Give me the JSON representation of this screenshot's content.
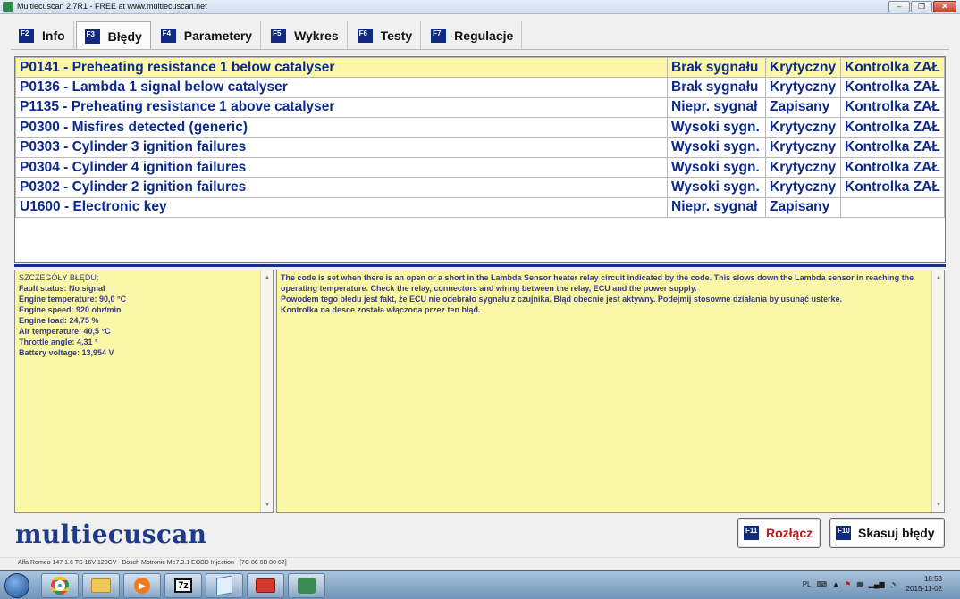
{
  "window": {
    "title": "Multiecuscan 2.7R1 - FREE at www.multiecuscan.net"
  },
  "tabs": [
    {
      "key": "F2",
      "label": "Info"
    },
    {
      "key": "F3",
      "label": "Błędy"
    },
    {
      "key": "F4",
      "label": "Parametery"
    },
    {
      "key": "F5",
      "label": "Wykres"
    },
    {
      "key": "F6",
      "label": "Testy"
    },
    {
      "key": "F7",
      "label": "Regulacje"
    }
  ],
  "errors": [
    {
      "code": "P0141 - Preheating resistance 1 below catalyser",
      "signal": "Brak sygnału",
      "type": "Krytyczny",
      "lamp": "Kontrolka ZAŁ"
    },
    {
      "code": "P0136 - Lambda 1 signal below catalyser",
      "signal": "Brak sygnału",
      "type": "Krytyczny",
      "lamp": "Kontrolka ZAŁ"
    },
    {
      "code": "P1135 - Preheating resistance 1 above catalyser",
      "signal": "Niepr. sygnał",
      "type": "Zapisany",
      "lamp": "Kontrolka ZAŁ"
    },
    {
      "code": "P0300 - Misfires detected (generic)",
      "signal": "Wysoki sygn.",
      "type": "Krytyczny",
      "lamp": "Kontrolka ZAŁ"
    },
    {
      "code": "P0303 - Cylinder 3 ignition failures",
      "signal": "Wysoki sygn.",
      "type": "Krytyczny",
      "lamp": "Kontrolka ZAŁ"
    },
    {
      "code": "P0304 - Cylinder 4 ignition failures",
      "signal": "Wysoki sygn.",
      "type": "Krytyczny",
      "lamp": "Kontrolka ZAŁ"
    },
    {
      "code": "P0302 - Cylinder 2 ignition failures",
      "signal": "Wysoki sygn.",
      "type": "Krytyczny",
      "lamp": "Kontrolka ZAŁ"
    },
    {
      "code": "U1600 - Electronic key",
      "signal": "Niepr. sygnał",
      "type": "Zapisany",
      "lamp": ""
    }
  ],
  "details": {
    "heading": "SZCZEGÓŁY BŁĘDU:",
    "lines": [
      "Fault status: No signal",
      "Engine temperature: 90,0 °C",
      "Engine speed: 920 obr/min",
      "Engine load: 24,75 %",
      "Air temperature: 40,5 °C",
      "Throttle angle: 4,31 °",
      "Battery voltage: 13,954 V"
    ]
  },
  "description": {
    "text": "The code is set when there is an open or a short in the Lambda Sensor heater relay circuit indicated by the code. This slows down the Lambda sensor in reaching the operating temperature. Check the relay, connectors and wiring between the relay, ECU and the power supply.\nPowodem tego błedu jest fakt, że ECU nie odebrało sygnału z czujnika. Błąd obecnie jest aktywny. Podejmij stosowne działania by usunąć usterkę.\nKontrolka na desce została włączona przez ten błąd."
  },
  "logo": "multiecuscan",
  "buttons": {
    "disconnect": {
      "key": "F11",
      "label": "Rozłącz",
      "color": "#c0171b"
    },
    "clear": {
      "key": "F10",
      "label": "Skasuj błędy",
      "color": "#111111"
    }
  },
  "statusbar": "Alfa Romeo 147 1.6 TS 16V 120CV - Bosch Motronic Me7.3.1 EOBD Injection - [7C 86 0B 80 62]",
  "taskbar": {
    "apps": [
      "start-orb",
      "chrome-icon",
      "explorer-icon",
      "media-icon",
      "7zip-icon",
      "notepad-icon",
      "toolbox-icon",
      "multiecuscan-icon"
    ],
    "sevenzip_label": "7z",
    "lang": "PL",
    "time": "18:53",
    "date": "2015-11-02"
  },
  "colors": {
    "accent": "#102a80",
    "error_text": "#0b2a8c",
    "selected_row": "#fbf6a8",
    "panel_yellow": "#faf7a6"
  }
}
